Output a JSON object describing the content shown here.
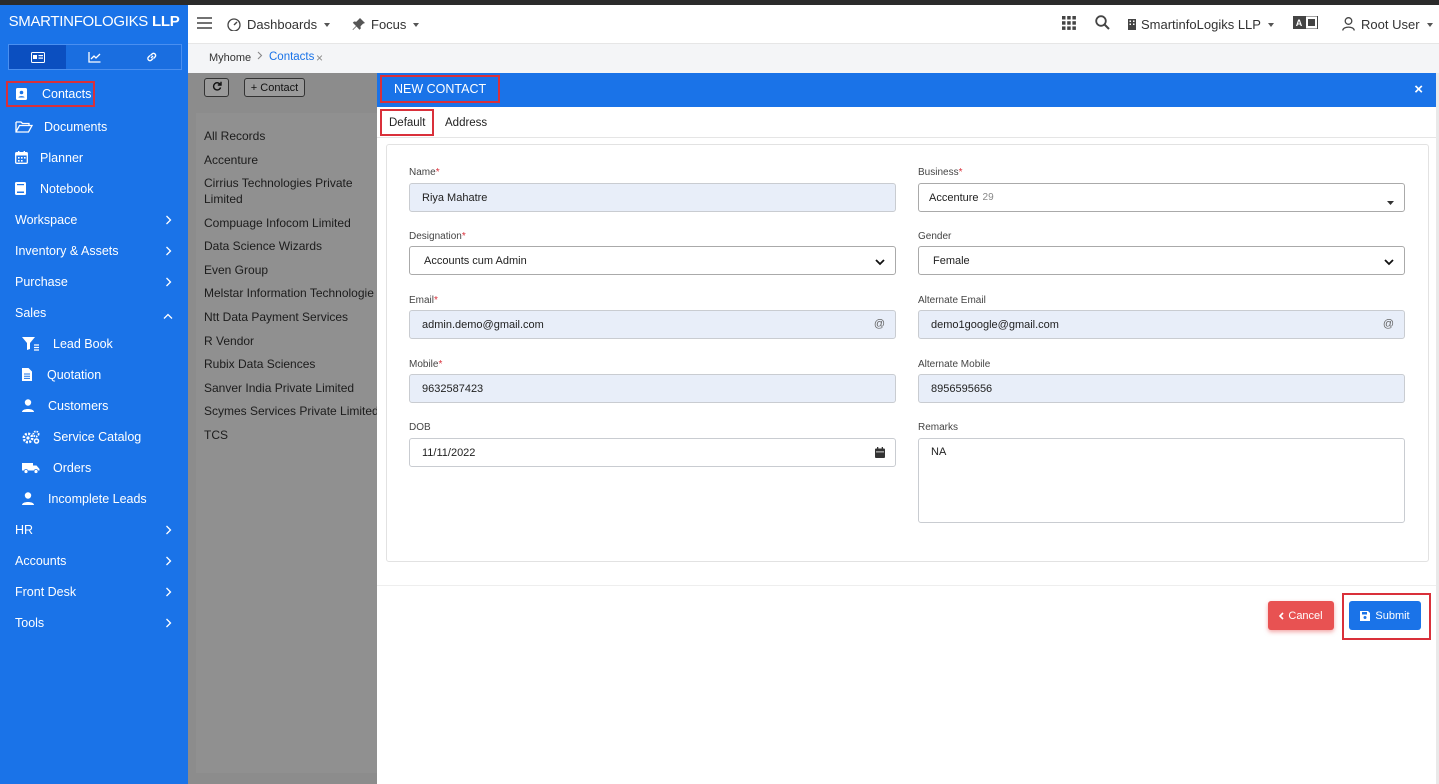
{
  "brand": {
    "name_light": "SMARTINFOLOGIKS",
    "name_bold": "LLP"
  },
  "sidebar_tabs": [
    {
      "icon": "id-card-icon",
      "active": true
    },
    {
      "icon": "chart-line-icon",
      "active": false
    },
    {
      "icon": "link-icon",
      "active": false
    }
  ],
  "sidebar": {
    "contacts": "Contacts",
    "documents": "Documents",
    "planner": "Planner",
    "notebook": "Notebook",
    "workspace": "Workspace",
    "inventory": "Inventory & Assets",
    "purchase": "Purchase",
    "sales": "Sales",
    "lead_book": "Lead Book",
    "quotation": "Quotation",
    "customers": "Customers",
    "service_catalog": "Service Catalog",
    "orders": "Orders",
    "incomplete_leads": "Incomplete Leads",
    "hr": "HR",
    "accounts": "Accounts",
    "front_desk": "Front Desk",
    "tools": "Tools"
  },
  "header": {
    "dashboards": "Dashboards",
    "focus": "Focus",
    "company": "SmartinfoLogiks LLP",
    "user": "Root User"
  },
  "breadcrumb": {
    "home": "Myhome",
    "current": "Contacts",
    "close": "×"
  },
  "list_toolbar": {
    "add_contact": "+ Contact"
  },
  "records": [
    "All Records",
    "Accenture",
    "Cirrius Technologies Private",
    "Limited",
    "Compuage Infocom Limited",
    "Data Science Wizards",
    "Even Group",
    "Melstar Information Technologie",
    "Ntt Data Payment Services",
    "R Vendor",
    "Rubix Data Sciences",
    "Sanver India Private Limited",
    "Scymes Services Private Limited",
    "TCS"
  ],
  "modal": {
    "title": "NEW CONTACT",
    "close": "×",
    "tabs": {
      "default": "Default",
      "address": "Address"
    },
    "labels": {
      "name": "Name",
      "business": "Business",
      "designation": "Designation",
      "gender": "Gender",
      "email": "Email",
      "alt_email": "Alternate Email",
      "mobile": "Mobile",
      "alt_mobile": "Alternate Mobile",
      "dob": "DOB",
      "remarks": "Remarks"
    },
    "required_mark": "*",
    "values": {
      "name": "Riya Mahatre",
      "business": "Accenture",
      "business_count": "29",
      "designation": "Accounts cum Admin",
      "gender": "Female",
      "email": "admin.demo@gmail.com",
      "alt_email": "demo1google@gmail.com",
      "mobile": "9632587423",
      "alt_mobile": "8956595656",
      "dob": "11/11/2022",
      "remarks": "NA"
    },
    "at_symbol": "@",
    "cancel": "Cancel",
    "submit": "Submit"
  },
  "colors": {
    "primary": "#1a73e8",
    "danger": "#e85252",
    "highlight": "#d9303a"
  }
}
